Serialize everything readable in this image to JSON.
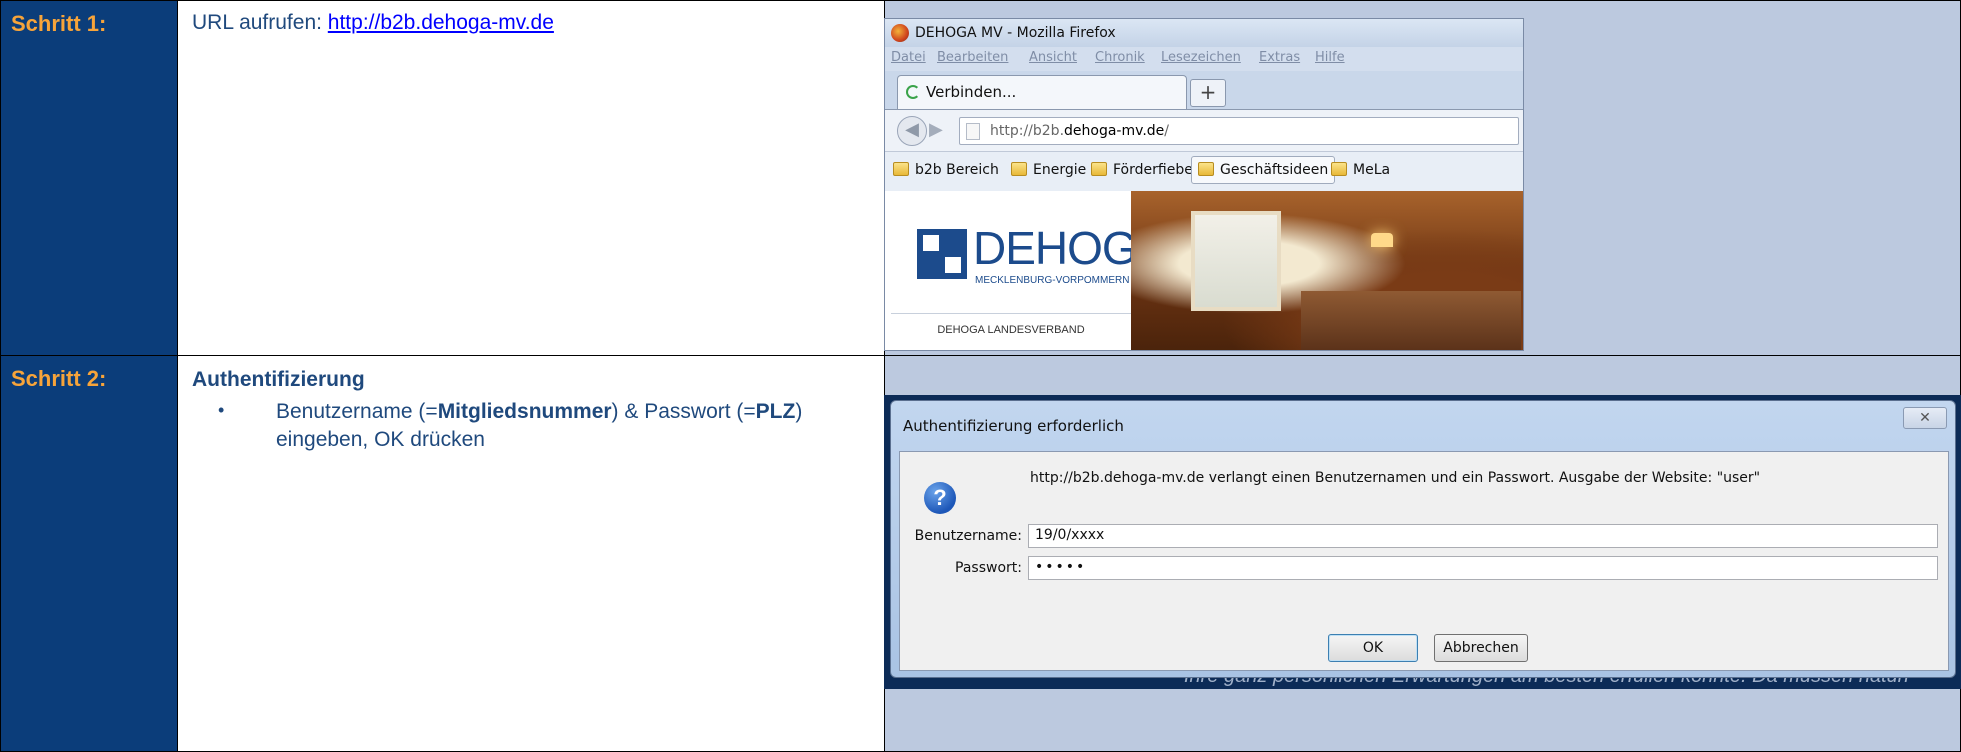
{
  "step1": {
    "label": "Schritt 1:",
    "text_prefix": "URL aufrufen: ",
    "url": "http://b2b.dehoga-mv.de",
    "browser": {
      "window_title": "DEHOGA MV - Mozilla Firefox",
      "menu": [
        "Datei",
        "Bearbeiten",
        "Ansicht",
        "Chronik",
        "Lesezeichen",
        "Extras",
        "Hilfe"
      ],
      "tab_label": "Verbinden...",
      "new_tab_symbol": "+",
      "address_prefix": "http://b2b.",
      "address_domain": "dehoga-mv.de",
      "address_suffix": "/",
      "bookmarks": [
        "b2b Bereich",
        "Energie",
        "Förderfiebel",
        "Geschäftsideen",
        "MeLa"
      ],
      "logo_name": "DEHOGA",
      "logo_region": "MECKLENBURG-VORPOMMERN",
      "logo_footer": "DEHOGA LANDESVERBAND"
    }
  },
  "step2": {
    "label": "Schritt 2:",
    "heading": "Authentifizierung",
    "bullet_part1": "Benutzername (=",
    "bullet_bold1": "Mitgliedsnummer",
    "bullet_part2": ") & Passwort (=",
    "bullet_bold2": "PLZ",
    "bullet_part3": ") eingeben, OK drücken",
    "dialog": {
      "title": "Authentifizierung erforderlich",
      "close_symbol": "✕",
      "message": "http://b2b.dehoga-mv.de verlangt einen Benutzernamen und ein Passwort. Ausgabe der Website: \"user\"",
      "username_label": "Benutzername:",
      "username_value": "19/0/xxxx",
      "password_label": "Passwort:",
      "password_value": "•••••",
      "ok_label": "OK",
      "cancel_label": "Abbrechen",
      "background_text": "Ihre ganz persönlichen Erwartungen am besten erfüllen könnte. Da müssen natürl"
    }
  }
}
